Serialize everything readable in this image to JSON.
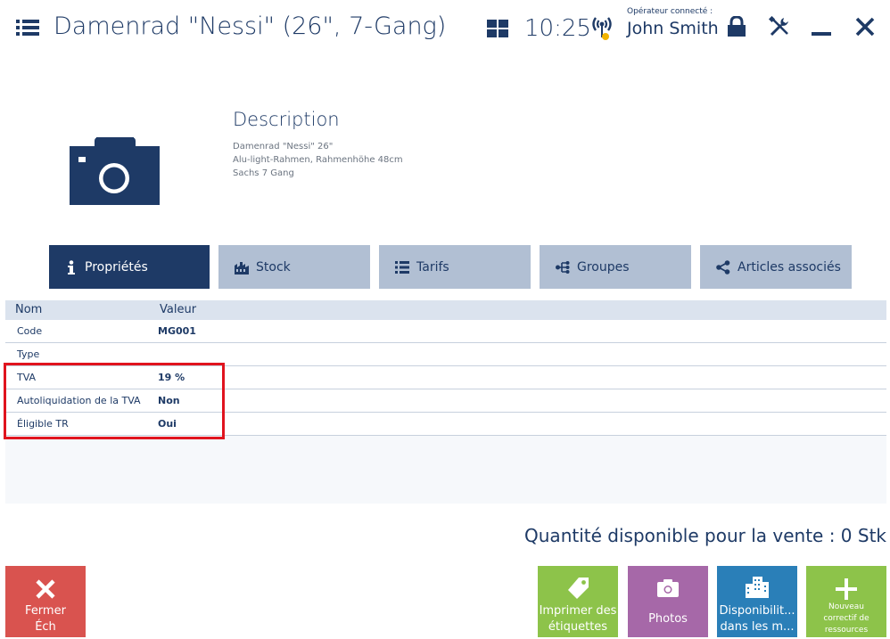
{
  "header": {
    "title": "Damenrad \"Nessi\" (26\", 7-Gang)",
    "time": "10:25",
    "operator_label": "Opérateur connecté :",
    "operator_name": "John Smith"
  },
  "icons": {
    "menu": "menu-icon",
    "tiles": "tiles-icon",
    "signal": "signal-icon",
    "lock": "lock-icon",
    "tools": "tools-icon",
    "minimize": "minimize-icon",
    "close": "close-icon",
    "item_image": "camera-icon"
  },
  "description": {
    "title": "Description",
    "lines": [
      "Damenrad \"Nessi\" 26\"",
      "Alu-light-Rahmen, Rahmenhöhe 48cm",
      "Sachs 7 Gang"
    ]
  },
  "tabs": [
    {
      "label": "Propriétés",
      "icon": "info-icon",
      "active": true
    },
    {
      "label": "Stock",
      "icon": "warehouse-icon",
      "active": false
    },
    {
      "label": "Tarifs",
      "icon": "list-icon",
      "active": false
    },
    {
      "label": "Groupes",
      "icon": "tree-icon",
      "active": false
    },
    {
      "label": "Articles associés",
      "icon": "share-icon",
      "active": false
    }
  ],
  "grid": {
    "columns": [
      "Nom",
      "Valeur"
    ],
    "rows": [
      {
        "name": "Code",
        "value": "MG001"
      },
      {
        "name": "Type",
        "value": ""
      },
      {
        "name": "TVA",
        "value": "19 %"
      },
      {
        "name": "Autoliquidation de la TVA",
        "value": "Non"
      },
      {
        "name": "Éligible TR",
        "value": "Oui"
      }
    ]
  },
  "quantity_text": "Quantité disponible pour la vente :  0 Stk",
  "buttons": {
    "close": {
      "line1": "Fermer",
      "line2": "Éch",
      "color": "#d9534f"
    },
    "labels": {
      "line1": "Imprimer des",
      "line2": "étiquettes",
      "color": "#8dc34a"
    },
    "photos": {
      "line1": "Photos",
      "color": "#a668a8"
    },
    "availability": {
      "line1": "Disponibilit...",
      "line2": "dans les m...",
      "color": "#2a7fb8"
    },
    "new_correction": {
      "line1": "Nouveau",
      "line2": "correctif de",
      "line3": "ressources",
      "color": "#8dc34a"
    }
  },
  "colors": {
    "primary": "#1e3a66",
    "tab_inactive": "#b1bfd3",
    "highlight": "#e0141e"
  }
}
